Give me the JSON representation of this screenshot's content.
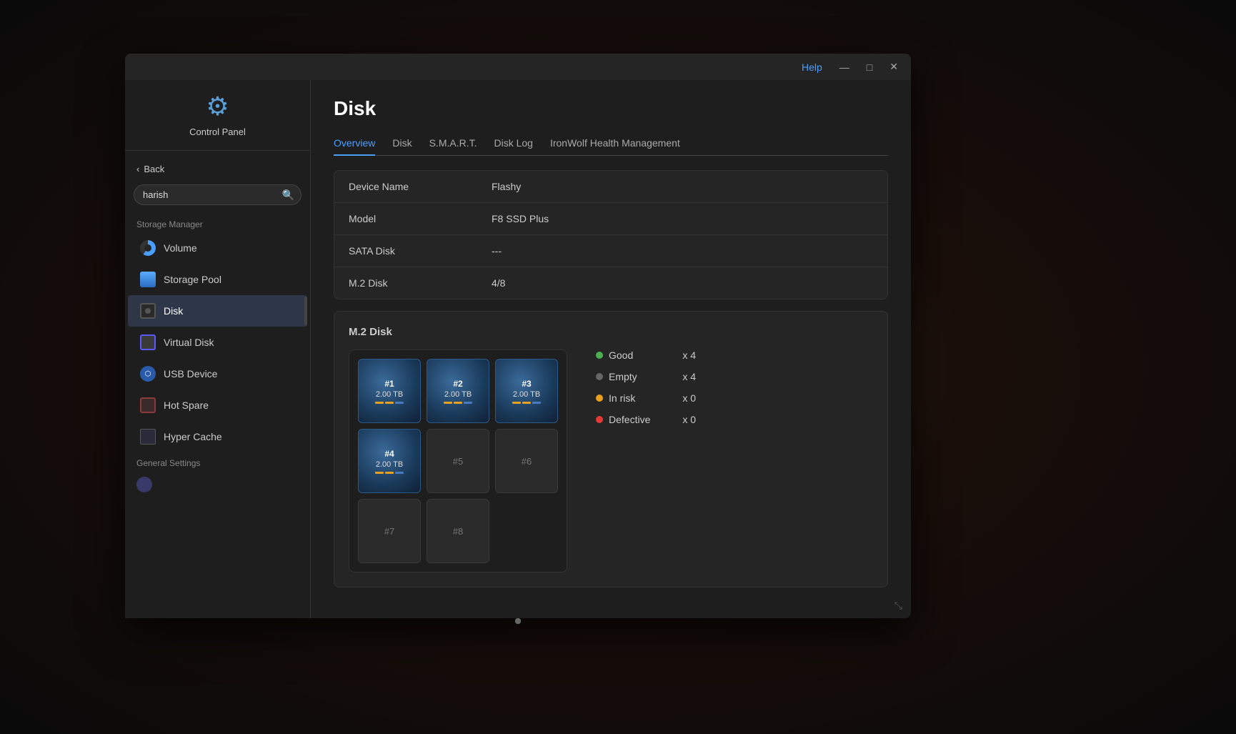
{
  "window": {
    "title": "Disk",
    "controls": {
      "help": "Help",
      "minimize": "—",
      "maximize": "□",
      "close": "✕"
    }
  },
  "sidebar": {
    "control_panel_label": "Control Panel",
    "back_button": "Back",
    "search_placeholder": "harish",
    "sections": [
      {
        "label": "Storage Manager",
        "items": [
          {
            "id": "volume",
            "label": "Volume",
            "icon": "volume-icon"
          },
          {
            "id": "storage-pool",
            "label": "Storage Pool",
            "icon": "storage-pool-icon"
          },
          {
            "id": "disk",
            "label": "Disk",
            "icon": "disk-icon",
            "active": true
          },
          {
            "id": "virtual-disk",
            "label": "Virtual Disk",
            "icon": "virtual-disk-icon"
          },
          {
            "id": "usb-device",
            "label": "USB Device",
            "icon": "usb-icon"
          },
          {
            "id": "hot-spare",
            "label": "Hot Spare",
            "icon": "hot-spare-icon"
          },
          {
            "id": "hyper-cache",
            "label": "Hyper Cache",
            "icon": "hyper-cache-icon"
          }
        ]
      },
      {
        "label": "General Settings",
        "items": []
      }
    ]
  },
  "main": {
    "page_title": "Disk",
    "tabs": [
      {
        "id": "overview",
        "label": "Overview",
        "active": true
      },
      {
        "id": "disk",
        "label": "Disk"
      },
      {
        "id": "smart",
        "label": "S.M.A.R.T."
      },
      {
        "id": "disk-log",
        "label": "Disk Log"
      },
      {
        "id": "ironwolf",
        "label": "IronWolf Health Management"
      }
    ],
    "info": {
      "device_name_label": "Device Name",
      "device_name_value": "Flashy",
      "model_label": "Model",
      "model_value": "F8 SSD Plus",
      "sata_disk_label": "SATA Disk",
      "sata_disk_value": "---",
      "m2_disk_label": "M.2 Disk",
      "m2_disk_value": "4/8"
    },
    "m2_disk": {
      "title": "M.2 Disk",
      "slots": [
        {
          "id": 1,
          "label": "#1",
          "size": "2.00 TB",
          "filled": true,
          "indicator": "green"
        },
        {
          "id": 2,
          "label": "#2",
          "size": "2.00 TB",
          "filled": true,
          "indicator": "green"
        },
        {
          "id": 3,
          "label": "#3",
          "size": "2.00 TB",
          "filled": true,
          "indicator": "green"
        },
        {
          "id": 4,
          "label": "#4",
          "size": "2.00 TB",
          "filled": true,
          "indicator": "green"
        },
        {
          "id": 5,
          "label": "#5",
          "size": "",
          "filled": false,
          "indicator": "gray"
        },
        {
          "id": 6,
          "label": "#6",
          "size": "",
          "filled": false,
          "indicator": "gray"
        },
        {
          "id": 7,
          "label": "#7",
          "size": "",
          "filled": false,
          "indicator": "none"
        },
        {
          "id": 8,
          "label": "#8",
          "size": "",
          "filled": false,
          "indicator": "none"
        }
      ],
      "legend": [
        {
          "id": "good",
          "label": "Good",
          "color": "green",
          "count": "x 4"
        },
        {
          "id": "empty",
          "label": "Empty",
          "color": "gray",
          "count": "x 4"
        },
        {
          "id": "in-risk",
          "label": "In risk",
          "color": "yellow",
          "count": "x 0"
        },
        {
          "id": "defective",
          "label": "Defective",
          "color": "red",
          "count": "x 0"
        }
      ]
    }
  }
}
